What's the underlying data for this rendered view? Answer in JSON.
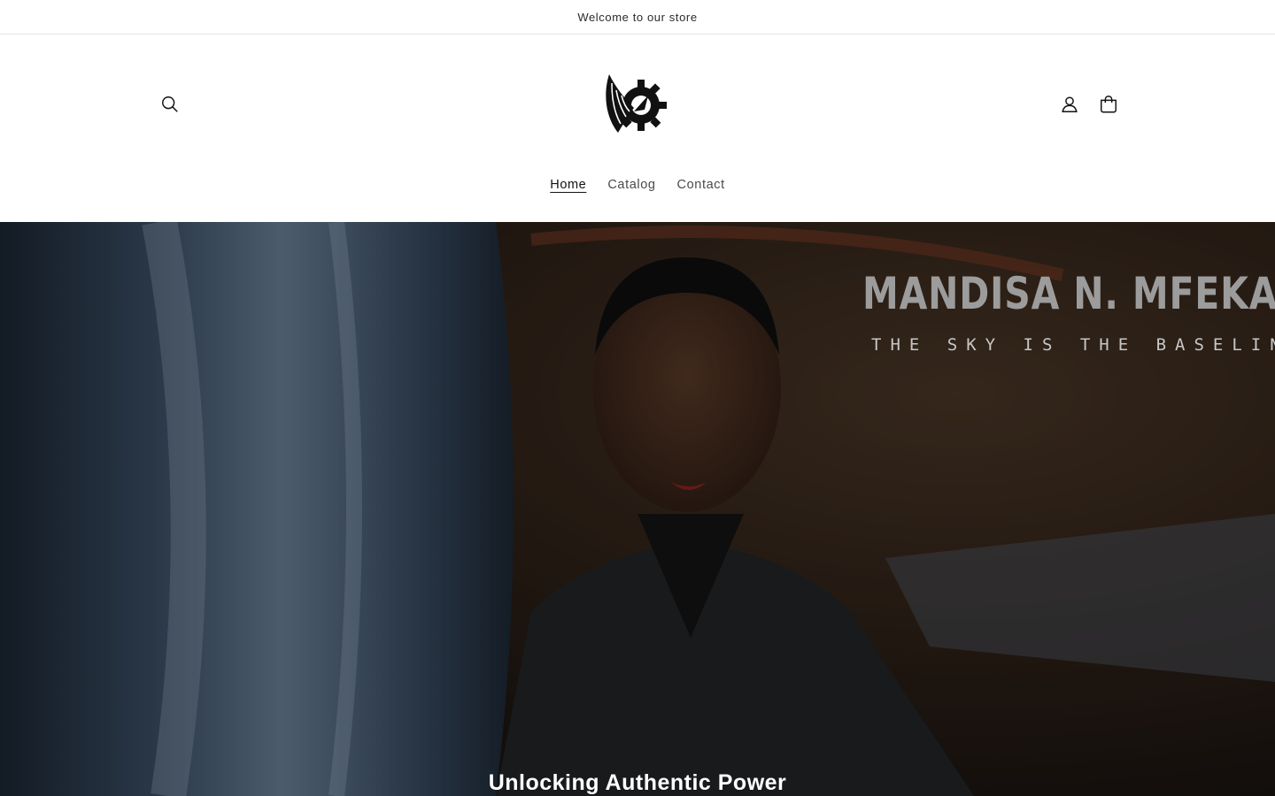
{
  "announcement": {
    "text": "Welcome to our store"
  },
  "header": {
    "icons": {
      "search": "search-icon",
      "account": "account-icon",
      "cart": "cart-icon",
      "logo": "winged-gear-logo"
    },
    "nav": [
      {
        "label": "Home",
        "active": true
      },
      {
        "label": "Catalog",
        "active": false
      },
      {
        "label": "Contact",
        "active": false
      }
    ]
  },
  "hero": {
    "name": "MANDISA N. MFEKA",
    "tagline": "THE SKY IS THE BASELINE",
    "heading": "Unlocking Authentic Power"
  }
}
